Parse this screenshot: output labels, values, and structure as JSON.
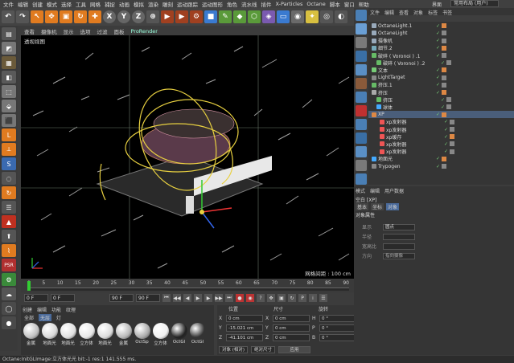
{
  "menubar": {
    "items": [
      "文件",
      "编辑",
      "创建",
      "模式",
      "选择",
      "工具",
      "网格",
      "捕捉",
      "动画",
      "模拟",
      "渲染",
      "雕刻",
      "运动跟踪",
      "运动图形",
      "角色",
      "流水线",
      "插件",
      "X-Particles",
      "Octane",
      "脚本",
      "窗口",
      "帮助"
    ],
    "layout_label": "界面",
    "layout_value": "常用布局 (用户)"
  },
  "toolbar": {
    "axis_x": "X",
    "axis_y": "Y",
    "axis_z": "Z"
  },
  "viewport": {
    "menu": [
      "查看",
      "摄像机",
      "显示",
      "选项",
      "过滤",
      "面板",
      "ProRender"
    ],
    "title": "透视视图",
    "grid_info": "网格间距 : 100 cm"
  },
  "timeline": {
    "ticks": [
      "0",
      "5",
      "10",
      "15",
      "20",
      "25",
      "30",
      "35",
      "40",
      "45",
      "50",
      "55",
      "60",
      "65",
      "70",
      "75",
      "80",
      "85",
      "90"
    ],
    "end_label": "0 F"
  },
  "transport": {
    "current": "0 F",
    "start": "0 F",
    "end": "90 F",
    "end2": "90 F"
  },
  "materials": {
    "tabs": [
      "创建",
      "编辑",
      "功能",
      "纹理"
    ],
    "sub": [
      "全部",
      "无层",
      "灯"
    ],
    "items": [
      {
        "name": "金属",
        "color": "#c0c0c0"
      },
      {
        "name": "地面光",
        "color": "#d8d8d8"
      },
      {
        "name": "地面光",
        "color": "#e0e0e0"
      },
      {
        "name": "立方体",
        "color": "#e8e8e8"
      },
      {
        "name": "地面光",
        "color": "#dcdcdc"
      },
      {
        "name": "金属",
        "color": "#b8b8b8"
      },
      {
        "name": "OctSp",
        "color": "#aaaaaa"
      },
      {
        "name": "立方体",
        "color": "#f0f0f0"
      },
      {
        "name": "OctGl",
        "color": "#222222"
      },
      {
        "name": "OctGl",
        "color": "#333333"
      }
    ]
  },
  "coords": {
    "headers": [
      "位置",
      "尺寸",
      "旋转"
    ],
    "rows": [
      {
        "axis": "X",
        "pos": "0 cm",
        "size": "0 cm",
        "rot_axis": "H",
        "rot": "0 °"
      },
      {
        "axis": "Y",
        "pos": "-15.021 cm",
        "size": "0 cm",
        "rot_axis": "P",
        "rot": "0 °"
      },
      {
        "axis": "Z",
        "pos": "-41.101 cm",
        "size": "0 cm",
        "rot_axis": "B",
        "rot": "0 °"
      }
    ],
    "mode": "对象 (相对)",
    "size_mode": "绝对尺寸",
    "apply": "应用"
  },
  "status": "Octane:InitGLImage:立方体光光 bit:-1 res:1 141.555 ms.",
  "objects": {
    "tabs": [
      "文件",
      "编辑",
      "查看",
      "对象",
      "标签",
      "书签"
    ],
    "rows": [
      {
        "name": "OctaneLight.1",
        "icon": "#9ab",
        "sel": false
      },
      {
        "name": "OctaneLight",
        "icon": "#9ab",
        "sel": false
      },
      {
        "name": "摄像机",
        "icon": "#9ab",
        "sel": false
      },
      {
        "name": "细节.2",
        "icon": "#7ab",
        "sel": false
      },
      {
        "name": "破碎 ( Voronoi ) .1",
        "icon": "#6b6",
        "sel": false
      },
      {
        "name": "破碎 ( Voronoi ) .2",
        "icon": "#6b6",
        "sel": false
      },
      {
        "name": "文本",
        "icon": "#7c7",
        "sel": false
      },
      {
        "name": "LightTarget",
        "icon": "#888",
        "sel": false
      },
      {
        "name": "挤压.1",
        "icon": "#6b6",
        "sel": false
      },
      {
        "name": "挤压",
        "icon": "#aaa",
        "sel": false
      },
      {
        "name": "挤压",
        "icon": "#6b6",
        "sel": false
      },
      {
        "name": "球体",
        "icon": "#4af",
        "sel": false
      },
      {
        "name": "XP",
        "icon": "#d84",
        "sel": true
      },
      {
        "name": "xp发射器",
        "icon": "#e55",
        "sel": false
      },
      {
        "name": "xp发射器",
        "icon": "#e55",
        "sel": false
      },
      {
        "name": "xp缓存",
        "icon": "#e55",
        "sel": false
      },
      {
        "name": "xp发射器",
        "icon": "#e55",
        "sel": false
      },
      {
        "name": "xp发射器",
        "icon": "#e55",
        "sel": false
      },
      {
        "name": "地面光",
        "icon": "#4af",
        "sel": false
      },
      {
        "name": "Trypogen",
        "icon": "#888",
        "sel": false
      }
    ]
  },
  "attributes": {
    "tabs": [
      "模式",
      "编辑",
      "用户数据"
    ],
    "name": "空白 [XP]",
    "sub": [
      "基本",
      "坐标",
      "对象"
    ],
    "section": "对象属性",
    "rows": [
      {
        "label": "显示",
        "value": "圆点"
      },
      {
        "label": "半径",
        "value": ""
      },
      {
        "label": "宽高比",
        "value": ""
      },
      {
        "label": "方向",
        "value": "指向摄像"
      }
    ]
  }
}
